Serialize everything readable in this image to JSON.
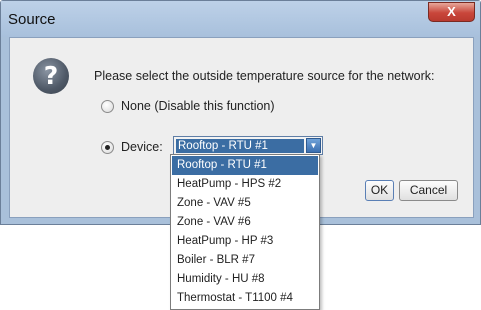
{
  "window": {
    "title": "Source",
    "close_glyph": "X"
  },
  "dialog": {
    "icon": "question-icon",
    "icon_glyph": "?",
    "prompt": "Please select the outside temperature source for the network:",
    "options": {
      "none_label": "None (Disable this function)",
      "none_selected": false,
      "device_label": "Device:",
      "device_selected": true
    },
    "device_combo": {
      "selected": "Rooftop - RTU #1",
      "arrow_glyph": "▼"
    },
    "buttons": {
      "ok": "OK",
      "cancel": "Cancel"
    }
  },
  "dropdown": {
    "items": [
      "Rooftop - RTU #1",
      "HeatPump - HPS #2",
      "Zone - VAV #5",
      "Zone - VAV #6",
      "HeatPump - HP #3",
      "Boiler - BLR #7",
      "Humidity - HU #8",
      "Thermostat - T1100 #4"
    ],
    "selected_index": 0
  },
  "colors": {
    "selection": "#3b6da3",
    "frame": "#a9c0da",
    "client_bg": "#eeeeee",
    "close_button": "#c9463b"
  }
}
